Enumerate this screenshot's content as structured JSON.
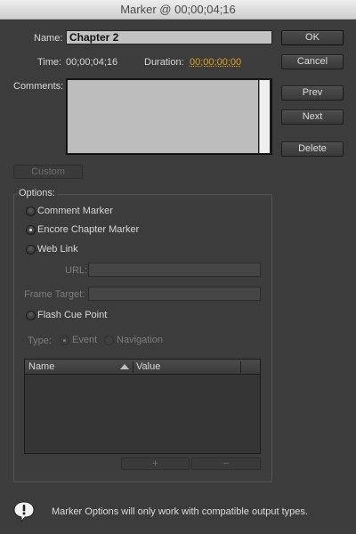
{
  "window": {
    "title": "Marker @ 00;00;04;16"
  },
  "fields": {
    "name_label": "Name:",
    "name_value": "Chapter 2",
    "time_label": "Time:",
    "time_value": "00;00;04;16",
    "duration_label": "Duration:",
    "duration_value": "00;00;00;00",
    "comments_label": "Comments:",
    "comments_value": ""
  },
  "buttons": {
    "ok": "OK",
    "cancel": "Cancel",
    "prev": "Prev",
    "next": "Next",
    "delete": "Delete",
    "custom": "Custom",
    "add": "+",
    "remove": "−"
  },
  "options": {
    "legend": "Options:",
    "comment_marker": "Comment Marker",
    "encore_chapter_marker": "Encore Chapter Marker",
    "web_link": "Web Link",
    "url_label": "URL:",
    "frame_target_label": "Frame Target:",
    "flash_cue_point": "Flash Cue Point",
    "type_label": "Type:",
    "type_event": "Event",
    "type_navigation": "Navigation",
    "selected": "Encore Chapter Marker"
  },
  "table": {
    "columns": [
      "Name",
      "Value"
    ]
  },
  "footer": {
    "message": "Marker Options will only work with compatible output types."
  },
  "colors": {
    "accent_timecode": "#e0a020",
    "background": "#3c3c3c"
  }
}
